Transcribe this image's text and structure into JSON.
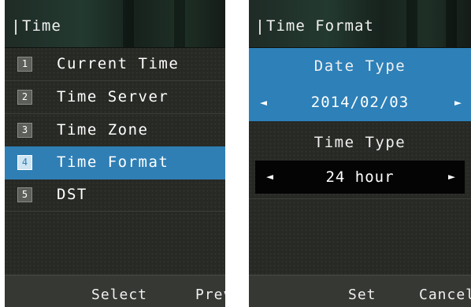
{
  "left_screen": {
    "title": "Time",
    "menu": [
      {
        "number": "1",
        "label": "Current Time",
        "selected": false
      },
      {
        "number": "2",
        "label": "Time Server",
        "selected": false
      },
      {
        "number": "3",
        "label": "Time Zone",
        "selected": false
      },
      {
        "number": "4",
        "label": "Time Format",
        "selected": true
      },
      {
        "number": "5",
        "label": "DST",
        "selected": false
      }
    ],
    "softkeys": {
      "select": "Select",
      "prev": "Prev"
    }
  },
  "right_screen": {
    "title": "Time Format",
    "date_type": {
      "label": "Date Type",
      "value": "2014/02/03",
      "focused": true
    },
    "time_type": {
      "label": "Time Type",
      "value": "24 hour",
      "focused": false
    },
    "softkeys": {
      "set": "Set",
      "cancel": "Cancel"
    }
  },
  "icons": {
    "left_arrow": "◄",
    "right_arrow": "►"
  },
  "colors": {
    "highlight": "#2f7fb5",
    "background": "#272925",
    "value_box": "#040404"
  }
}
